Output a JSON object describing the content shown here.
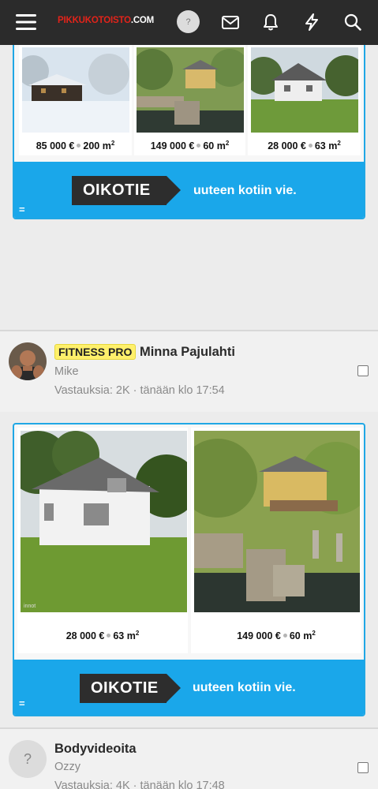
{
  "header": {
    "logo_red": "PIKKUKOTOISTO",
    "logo_white": ".COM",
    "help_label": "?",
    "icons": [
      "menu-icon",
      "help-icon",
      "mail-icon",
      "bell-icon",
      "bolt-icon",
      "search-icon"
    ]
  },
  "ad1": {
    "listings": [
      {
        "price": "85 000 €",
        "area": "200 m",
        "unit_sup": "2"
      },
      {
        "price": "149 000 €",
        "area": "60 m",
        "unit_sup": "2"
      },
      {
        "price": "28 000 €",
        "area": "63 m",
        "unit_sup": "2"
      }
    ],
    "brand": "OIKOTIE",
    "slogan": "uuteen kotiin vie.",
    "menu_glyph": "="
  },
  "thread1": {
    "badge": "FITNESS PRO",
    "title": "Minna Pajulahti",
    "author": "Mike",
    "replies": "Vastauksia: 2K",
    "separator": "·",
    "time": "tänään klo 17:54"
  },
  "ad2": {
    "listings": [
      {
        "price": "28 000 €",
        "area": "63 m",
        "unit_sup": "2"
      },
      {
        "price": "149 000 €",
        "area": "60 m",
        "unit_sup": "2"
      }
    ],
    "watermark": "innot",
    "brand": "OIKOTIE",
    "slogan": "uuteen kotiin vie.",
    "menu_glyph": "="
  },
  "thread2": {
    "avatar_placeholder": "?",
    "title": "Bodyvideoita",
    "author": "Ozzy",
    "replies": "Vastauksia: 4K",
    "separator": "·",
    "time": "tänään klo 17:48"
  },
  "colors": {
    "topbar": "#2b2b2b",
    "logo_red": "#e2231a",
    "ad_blue": "#1aa7ea",
    "badge_yellow": "#fff06b"
  }
}
